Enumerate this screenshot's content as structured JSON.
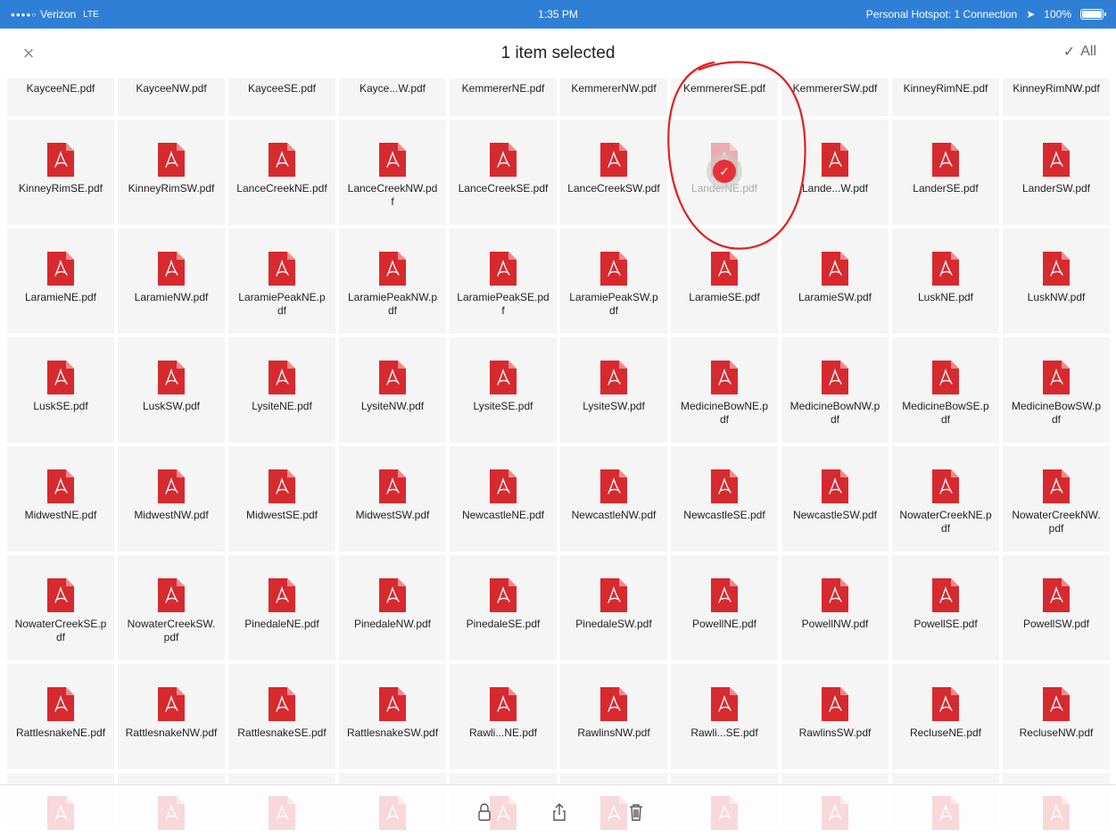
{
  "status_bar": {
    "carrier": "Verizon",
    "network": "LTE",
    "time": "1:35 PM",
    "hotspot": "Personal Hotspot: 1 Connection",
    "battery": "100%"
  },
  "nav": {
    "title": "1 item selected",
    "all_label": "All"
  },
  "files": [
    "KayceeNE.pdf",
    "KayceeNW.pdf",
    "KayceeSE.pdf",
    "Kayce...W.pdf",
    "KemmererNE.pdf",
    "KemmererNW.pdf",
    "KemmererSE.pdf",
    "KemmererSW.pdf",
    "KinneyRimNE.pdf",
    "KinneyRimNW.pdf",
    "KinneyRimSE.pdf",
    "KinneyRimSW.pdf",
    "LanceCreekNE.pdf",
    "LanceCreekNW.pdf",
    "LanceCreekSE.pdf",
    "LanceCreekSW.pdf",
    "LanderNE.pdf",
    "Lande...W.pdf",
    "LanderSE.pdf",
    "LanderSW.pdf",
    "LaramieNE.pdf",
    "LaramieNW.pdf",
    "LaramiePeakNE.pdf",
    "LaramiePeakNW.pdf",
    "LaramiePeakSE.pdf",
    "LaramiePeakSW.pdf",
    "LaramieSE.pdf",
    "LaramieSW.pdf",
    "LuskNE.pdf",
    "LuskNW.pdf",
    "LuskSE.pdf",
    "LuskSW.pdf",
    "LysiteNE.pdf",
    "LysiteNW.pdf",
    "LysiteSE.pdf",
    "LysiteSW.pdf",
    "MedicineBowNE.pdf",
    "MedicineBowNW.pdf",
    "MedicineBowSE.pdf",
    "MedicineBowSW.pdf",
    "MidwestNE.pdf",
    "MidwestNW.pdf",
    "MidwestSE.pdf",
    "MidwestSW.pdf",
    "NewcastleNE.pdf",
    "NewcastleNW.pdf",
    "NewcastleSE.pdf",
    "NewcastleSW.pdf",
    "NowaterCreekNE.pdf",
    "NowaterCreekNW.pdf",
    "NowaterCreekSE.pdf",
    "NowaterCreekSW.pdf",
    "PinedaleNE.pdf",
    "PinedaleNW.pdf",
    "PinedaleSE.pdf",
    "PinedaleSW.pdf",
    "PowellNE.pdf",
    "PowellNW.pdf",
    "PowellSE.pdf",
    "PowellSW.pdf",
    "RattlesnakeNE.pdf",
    "RattlesnakeNW.pdf",
    "RattlesnakeSE.pdf",
    "RattlesnakeSW.pdf",
    "Rawli...NE.pdf",
    "RawlinsNW.pdf",
    "Rawli...SE.pdf",
    "RawlinsSW.pdf",
    "RecluseNE.pdf",
    "RecluseNW.pdf"
  ],
  "selected_index": 16,
  "partial_row_count": 10,
  "icons": {
    "file": "pdf-file-icon",
    "selected": "checkmark-icon",
    "close": "close-icon",
    "lock": "lock-icon",
    "share": "share-icon",
    "trash": "trash-icon"
  },
  "colors": {
    "status_bar": "#2f7fd6",
    "pdf_red": "#d62a2f",
    "selection": "#e8303a"
  }
}
